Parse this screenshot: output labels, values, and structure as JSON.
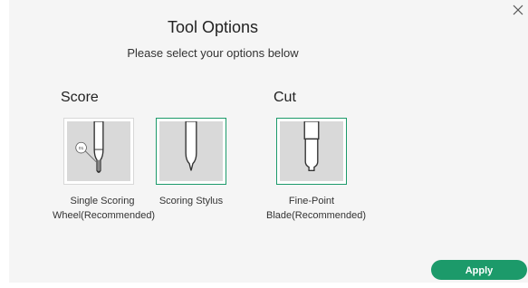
{
  "dialog": {
    "title": "Tool Options",
    "subtitle": "Please select your options below",
    "close_icon": "close-icon"
  },
  "sections": {
    "score": {
      "label": "Score",
      "tools": [
        {
          "label": "Single Scoring Wheel(Recommended)",
          "badge": "01",
          "selected": false,
          "icon": "scoring-wheel-icon"
        },
        {
          "label": "Scoring Stylus",
          "selected": true,
          "icon": "scoring-stylus-icon"
        }
      ]
    },
    "cut": {
      "label": "Cut",
      "tools": [
        {
          "label": "Fine-Point Blade(Recommended)",
          "selected": true,
          "icon": "fine-point-blade-icon"
        }
      ]
    }
  },
  "actions": {
    "apply_label": "Apply"
  },
  "colors": {
    "accent": "#1c9a6a",
    "panel": "#f5f5f5",
    "tile": "#d9d9d9"
  }
}
